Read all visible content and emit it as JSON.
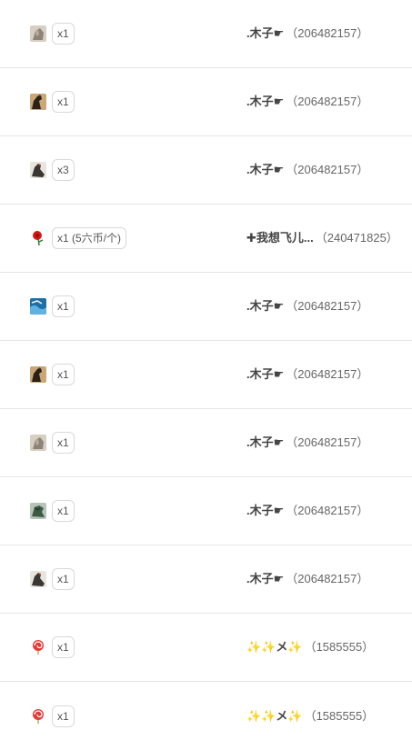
{
  "gift_records": [
    {
      "gift_icon": "gift-rock-icon",
      "quantity": "x1",
      "sender_name": ".木子☛",
      "sender_id": "（206482157）"
    },
    {
      "gift_icon": "gift-horse-icon",
      "quantity": "x1",
      "sender_name": ".木子☛",
      "sender_id": "（206482157）"
    },
    {
      "gift_icon": "gift-eagle-icon",
      "quantity": "x3",
      "sender_name": ".木子☛",
      "sender_id": "（206482157）"
    },
    {
      "gift_icon": "gift-rose-icon",
      "quantity": "x1 (5六币/个)",
      "sender_name": "✚我想飞儿...",
      "sender_id": "（240471825）"
    },
    {
      "gift_icon": "gift-wave-icon",
      "quantity": "x1",
      "sender_name": ".木子☛",
      "sender_id": "（206482157）"
    },
    {
      "gift_icon": "gift-horse-icon",
      "quantity": "x1",
      "sender_name": ".木子☛",
      "sender_id": "（206482157）"
    },
    {
      "gift_icon": "gift-rock-icon",
      "quantity": "x1",
      "sender_name": ".木子☛",
      "sender_id": "（206482157）"
    },
    {
      "gift_icon": "gift-dragon-icon",
      "quantity": "x1",
      "sender_name": ".木子☛",
      "sender_id": "（206482157）"
    },
    {
      "gift_icon": "gift-eagle-icon",
      "quantity": "x1",
      "sender_name": ".木子☛",
      "sender_id": "（206482157）"
    },
    {
      "gift_icon": "gift-lollipop-icon",
      "quantity": "x1",
      "sender_name": "✨✨メ✨",
      "sender_id": "（1585555）"
    },
    {
      "gift_icon": "gift-lollipop-icon",
      "quantity": "x1",
      "sender_name": "✨✨メ✨",
      "sender_id": "（1585555）"
    }
  ],
  "colors": {
    "divider": "#e6e6e6",
    "badge_border": "#d9d9d9",
    "name_text": "#444444",
    "id_text": "#666666"
  }
}
